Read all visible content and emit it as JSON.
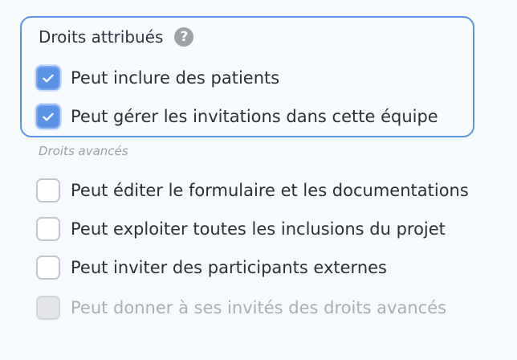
{
  "granted_rights": {
    "title": "Droits attribués",
    "help_icon": "question-circle-icon",
    "items": [
      {
        "label": "Peut inclure des patients",
        "checked": true
      },
      {
        "label": "Peut gérer les invitations dans cette équipe",
        "checked": true
      }
    ]
  },
  "advanced_rights": {
    "title": "Droits avancés",
    "items": [
      {
        "label": "Peut éditer le formulaire et les documentations",
        "checked": false,
        "disabled": false
      },
      {
        "label": "Peut exploiter toutes les inclusions du projet",
        "checked": false,
        "disabled": false
      },
      {
        "label": "Peut inviter des participants externes",
        "checked": false,
        "disabled": false
      },
      {
        "label": "Peut donner à ses invités des droits avancés",
        "checked": false,
        "disabled": true
      }
    ]
  },
  "colors": {
    "accent": "#5b93e6",
    "background": "#f6f9fd",
    "muted_text": "#9aa0a8",
    "disabled_text": "#a9adb4"
  }
}
